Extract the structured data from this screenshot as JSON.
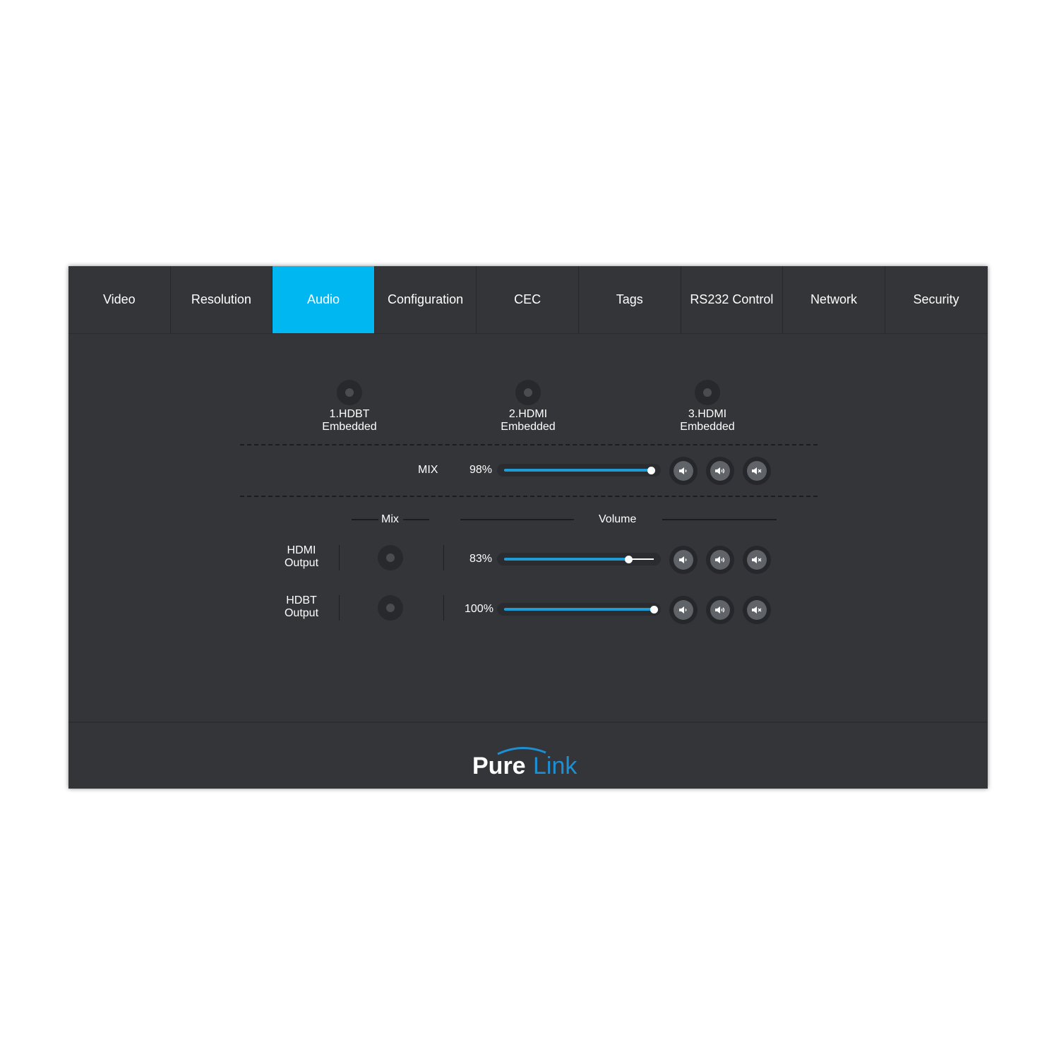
{
  "tabs": [
    {
      "label": "Video",
      "active": false
    },
    {
      "label": "Resolution",
      "active": false
    },
    {
      "label": "Audio",
      "active": true
    },
    {
      "label": "Configuration",
      "active": false
    },
    {
      "label": "CEC",
      "active": false
    },
    {
      "label": "Tags",
      "active": false
    },
    {
      "label": "RS232 Control",
      "active": false
    },
    {
      "label": "Network",
      "active": false
    },
    {
      "label": "Security",
      "active": false
    }
  ],
  "sources": [
    {
      "line1": "1.HDBT",
      "line2": "Embedded"
    },
    {
      "line1": "2.HDMI",
      "line2": "Embedded"
    },
    {
      "line1": "3.HDMI",
      "line2": "Embedded"
    }
  ],
  "mix": {
    "label": "MIX",
    "volume_text": "98%",
    "volume": 98
  },
  "headers": {
    "mix": "Mix",
    "volume": "Volume"
  },
  "outputs": [
    {
      "line1": "HDMI",
      "line2": "Output",
      "volume_text": "83%",
      "volume": 83
    },
    {
      "line1": "HDBT",
      "line2": "Output",
      "volume_text": "100%",
      "volume": 100
    }
  ],
  "volume_buttons": [
    "volume-down-icon",
    "volume-up-icon",
    "mute-icon"
  ],
  "logo": {
    "word1": "Pure",
    "word2": "Link"
  },
  "colors": {
    "accent": "#00b7f1",
    "panel": "#333539",
    "slider_fill": "#1f9bd6",
    "logo_blue": "#1e8fd3"
  }
}
